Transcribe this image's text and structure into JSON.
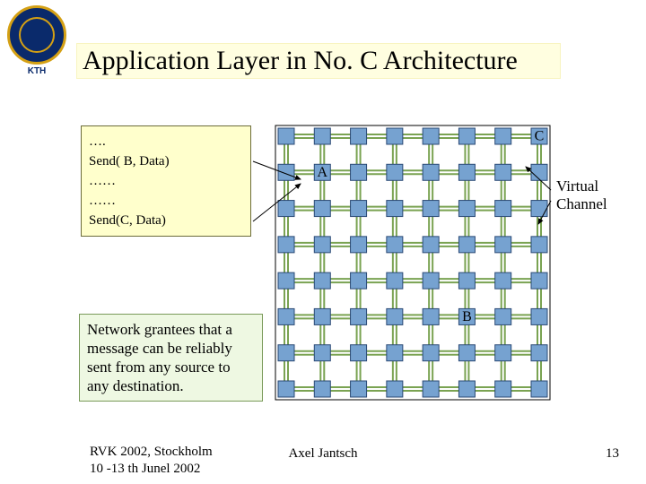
{
  "logo": {
    "sub": "KTH"
  },
  "title": "Application Layer in No. C Architecture",
  "code": {
    "l1": "….",
    "l2": "Send( B, Data)",
    "l3": "……",
    "l4": "……",
    "l5": "Send(C, Data)"
  },
  "nodes": {
    "A": "A",
    "B": "B",
    "C": "C"
  },
  "vc_label_1": "Virtual",
  "vc_label_2": "Channel",
  "callout": "Network grantees that a message can be reliably sent from any source to any destination.",
  "footer": {
    "venue": "RVK 2002, Stockholm",
    "dates": "10 -13 th Junel 2002",
    "author": "Axel Jantsch",
    "page": "13"
  },
  "colors": {
    "sw_fill": "#76a2d0",
    "link": "#7aa352",
    "frame": "#000000",
    "arrow": "#000000"
  }
}
